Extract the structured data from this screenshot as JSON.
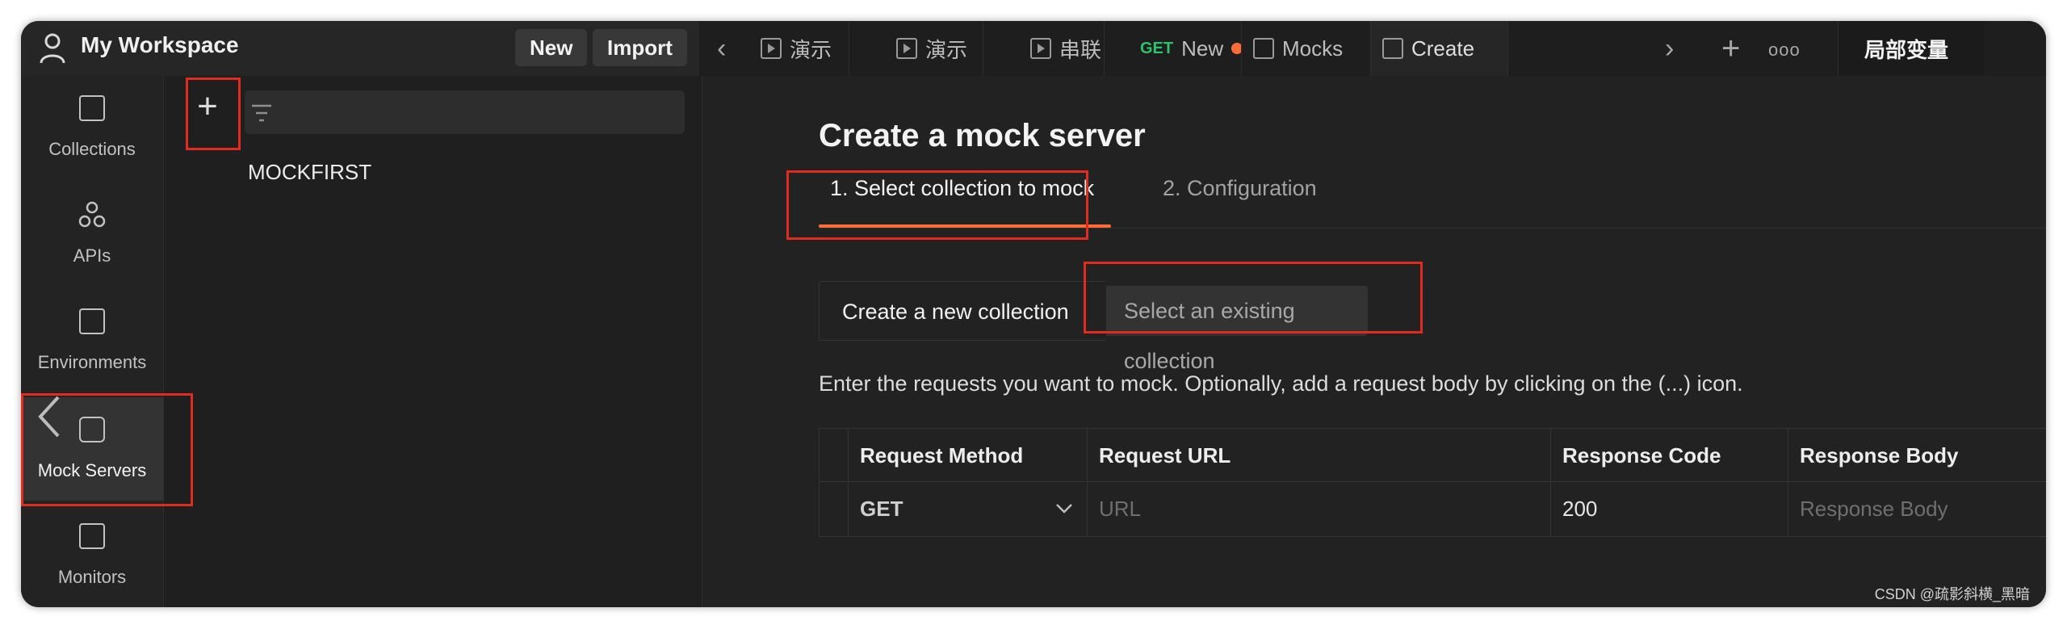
{
  "header": {
    "workspace_title": "My Workspace",
    "new_label": "New",
    "import_label": "Import",
    "tabs": [
      {
        "label": "演示",
        "icon": "play-icon"
      },
      {
        "label": "演示",
        "icon": "play-icon"
      },
      {
        "label": "串联",
        "icon": "play-icon"
      },
      {
        "method": "GET",
        "label": "New"
      },
      {
        "label": "Mocks",
        "icon": "mock-server-icon"
      },
      {
        "label": "Create",
        "icon": "mock-server-icon"
      }
    ],
    "env_label": "局部变量"
  },
  "rail": {
    "items": [
      {
        "label": "Collections",
        "icon": "collections-icon"
      },
      {
        "label": "APIs",
        "icon": "apis-icon"
      },
      {
        "label": "Environments",
        "icon": "environments-icon"
      },
      {
        "label": "Mock Servers",
        "icon": "mock-servers-icon",
        "active": true
      },
      {
        "label": "Monitors",
        "icon": "monitors-icon"
      }
    ]
  },
  "sidebar": {
    "items": [
      {
        "label": "MOCKFIRST"
      }
    ]
  },
  "main": {
    "title": "Create a mock server",
    "steps": [
      {
        "label": "1.  Select collection to mock",
        "active": true
      },
      {
        "label": "2.  Configuration",
        "active": false
      }
    ],
    "options": {
      "new_collection": "Create a new collection",
      "existing_collection": "Select an existing collection"
    },
    "description": "Enter the requests you want to mock. Optionally, add a request body by clicking on the (...) icon.",
    "table": {
      "headers": [
        "Request Method",
        "Request URL",
        "Response Code",
        "Response Body"
      ],
      "rows": [
        {
          "method": "GET",
          "url_placeholder": "URL",
          "code": "200",
          "body_placeholder": "Response Body"
        }
      ]
    }
  },
  "watermark": "CSDN @疏影斜横_黑暗",
  "colors": {
    "accent": "#ff6c37",
    "highlight_box": "#e02b1f",
    "get_method": "#2bc46b"
  }
}
